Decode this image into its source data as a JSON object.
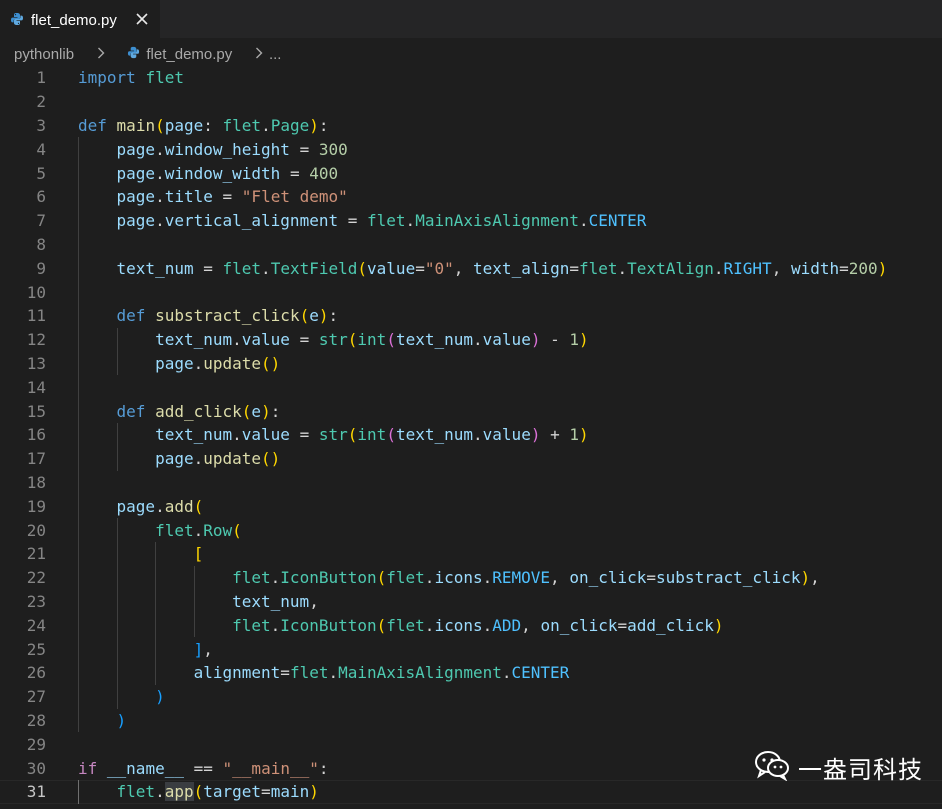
{
  "tab": {
    "label": "flet_demo.py",
    "icon": "python-file-icon",
    "close_icon": "close-icon"
  },
  "breadcrumb": {
    "folder": "pythonlib",
    "file": "flet_demo.py",
    "ellipsis": "..."
  },
  "editor": {
    "language": "python",
    "active_line": 31,
    "line_numbers": [
      "1",
      "2",
      "3",
      "4",
      "5",
      "6",
      "7",
      "8",
      "9",
      "10",
      "11",
      "12",
      "13",
      "14",
      "15",
      "16",
      "17",
      "18",
      "19",
      "20",
      "21",
      "22",
      "23",
      "24",
      "25",
      "26",
      "27",
      "28",
      "29",
      "30",
      "31"
    ],
    "lines": [
      "import flet",
      "",
      "def main(page: flet.Page):",
      "    page.window_height = 300",
      "    page.window_width = 400",
      "    page.title = \"Flet demo\"",
      "    page.vertical_alignment = flet.MainAxisAlignment.CENTER",
      "",
      "    text_num = flet.TextField(value=\"0\", text_align=flet.TextAlign.RIGHT, width=200)",
      "",
      "    def substract_click(e):",
      "        text_num.value = str(int(text_num.value) - 1)",
      "        page.update()",
      "",
      "    def add_click(e):",
      "        text_num.value = str(int(text_num.value) + 1)",
      "        page.update()",
      "",
      "    page.add(",
      "        flet.Row(",
      "            [",
      "                flet.IconButton(flet.icons.REMOVE, on_click=substract_click),",
      "                text_num,",
      "                flet.IconButton(flet.icons.ADD, on_click=add_click)",
      "            ],",
      "            alignment=flet.MainAxisAlignment.CENTER",
      "        )",
      "    )",
      "",
      "if __name__ == \"__main__\":",
      "    flet.app(target=main)"
    ]
  },
  "watermark": {
    "icon": "wechat-icon",
    "text": "一盎司科技"
  },
  "colors": {
    "background": "#1e1e1e",
    "tabbar": "#252526",
    "keyword": "#569cd6",
    "control": "#c586c0",
    "function": "#dcdcaa",
    "variable": "#9cdcfe",
    "class": "#4ec9b0",
    "string": "#ce9178",
    "number": "#b5cea8",
    "constant": "#4fc1ff"
  }
}
